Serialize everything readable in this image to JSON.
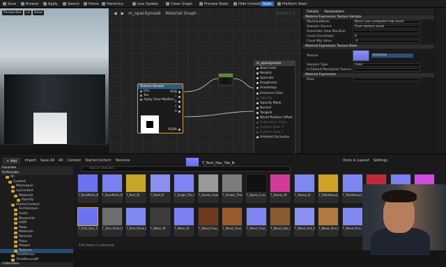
{
  "toolbar": {
    "items": [
      "Save",
      "Browse",
      "Apply",
      "Search",
      "Home",
      "Hierarchy",
      "Live Update",
      "Clean Graph",
      "Preview State",
      "Hide Unrelated",
      "Stats",
      "Platform Stats"
    ]
  },
  "viewport": {
    "chips": [
      "Perspective",
      "Lit",
      "Show"
    ]
  },
  "graph": {
    "title": "m_opacitymask",
    "crumb": "Material Graph",
    "zoom": "Zoom 1:1"
  },
  "texture_node": {
    "title": "Texture Sample",
    "inputs": [
      "UVs",
      "Tex",
      "Apply View MipBias"
    ],
    "outputs": [
      "RGB",
      "R",
      "G",
      "B",
      "A",
      "RGBA"
    ]
  },
  "material_node": {
    "title": "m_opacitymask",
    "pins": [
      "Base Color",
      "Metallic",
      "Specular",
      "Roughness",
      "Anisotropy",
      "Emissive Color",
      "Opacity",
      "Opacity Mask",
      "Normal",
      "Tangent",
      "World Position Offset",
      "Subsurface Color",
      "Custom Data 0",
      "Custom Data 1",
      "Ambient Occlusion"
    ],
    "dim": [
      6,
      11,
      12,
      13
    ]
  },
  "details": {
    "tabs": [
      "Details",
      "Parameters"
    ],
    "sec1": "Material Expression Texture Sample",
    "rows1": [
      {
        "k": "MipValueMode",
        "v": "None (use computed mip level)"
      },
      {
        "k": "Sampler Source",
        "v": "From texture asset"
      },
      {
        "k": "Automatic View Mip Bias",
        "v": ""
      },
      {
        "k": "Const Coordinate",
        "v": "0"
      },
      {
        "k": "Const Mip Value",
        "v": "-1"
      }
    ],
    "sec2": "Material Expression Texture Base",
    "tex_label": "Texture",
    "tex_value": "Unlinked",
    "rows2": [
      {
        "k": "Sampler Type",
        "v": "Color"
      },
      {
        "k": "Is Default Meshpaint Texture",
        "v": ""
      }
    ],
    "sec3": "Material Expression",
    "rows3": [
      {
        "k": "Desc",
        "v": ""
      }
    ]
  },
  "content": {
    "add": "+ Add",
    "import": "Import",
    "save_all": "Save All",
    "crumbs": [
      "All",
      "Content",
      "StarterContent",
      "Textures"
    ],
    "search_placeholder": "Search Textures",
    "drag_label": "T_Tech_Hex_Tile_N",
    "dock": "Dock in Layout",
    "settings": "Settings",
    "items_count": "104 items (1 selected)",
    "favorites": "Favorites",
    "root": "forYoutube",
    "collections": "Collections"
  },
  "tree": [
    "All",
    "Content",
    "Mannequin",
    "myContent",
    "Materials",
    "Opacity",
    "StarterContent",
    "Architecture",
    "Audio",
    "Blueprints",
    "HDRI",
    "Maps",
    "Materials",
    "Particles",
    "Props",
    "Shapes",
    "Textures",
    "ThirdPerson",
    "ThirdPersonBP"
  ],
  "tiles": [
    {
      "l": "T_RockMesh_N",
      "c": "#6c72f0"
    },
    {
      "l": "T_RockMesh_N",
      "c": "#7a7ff2"
    },
    {
      "l": "T_Roof_M",
      "c": "#c8a62a"
    },
    {
      "l": "T_Shelf_N",
      "c": "#8a8ff0"
    },
    {
      "l": "T_Single_Tile_N",
      "c": "#7f85f4"
    },
    {
      "l": "T_Smoke_SubUV",
      "c": "#9a9a9a"
    },
    {
      "l": "T_Smoke_Tiled_D",
      "c": "#7c7c7c"
    },
    {
      "l": "T_Spark_Core",
      "c": "#111111"
    },
    {
      "l": "T_Statue_M",
      "c": "#d23a9a"
    },
    {
      "l": "T_Statue_N",
      "c": "#8088f2"
    },
    {
      "l": "T_TableRound_M",
      "c": "#d0a028"
    },
    {
      "l": "T_TableRound_N",
      "c": "#7f86f4"
    },
    {
      "l": "T_Tech_Dot_M",
      "c": "#c3283a"
    },
    {
      "l": "T_Tech_Dot_N",
      "c": "#7b80f0"
    },
    {
      "l": "T_Tech_Hex_Tile_M",
      "c": "#d04be0"
    },
    {
      "l": "T_Tech_Hex_Tile_N",
      "c": "#6d73ee"
    },
    {
      "l": "T_Tech_Panel_M",
      "c": "#6e6e6e"
    },
    {
      "l": "T_Tech_Panel_N",
      "c": "#8088f2"
    },
    {
      "l": "T_Water_M",
      "c": "#3c3c3c"
    },
    {
      "l": "T_Water_N",
      "c": "#7a80f2"
    },
    {
      "l": "T_Wood_Floor_Walnut_D",
      "c": "#6e3a1e"
    },
    {
      "l": "T_Wood_Floor_Walnut_M",
      "c": "#9a5a2e"
    },
    {
      "l": "T_Wood_Floor_Walnut_N",
      "c": "#7f86f2"
    },
    {
      "l": "T_Wood_Oak_D",
      "c": "#8a5a30"
    },
    {
      "l": "T_Wood_Oak_N",
      "c": "#8a90f2"
    },
    {
      "l": "T_Wood_Pine_D",
      "c": "#b07a40"
    },
    {
      "l": "T_Wood_Pine_N",
      "c": "#8288f2"
    }
  ]
}
